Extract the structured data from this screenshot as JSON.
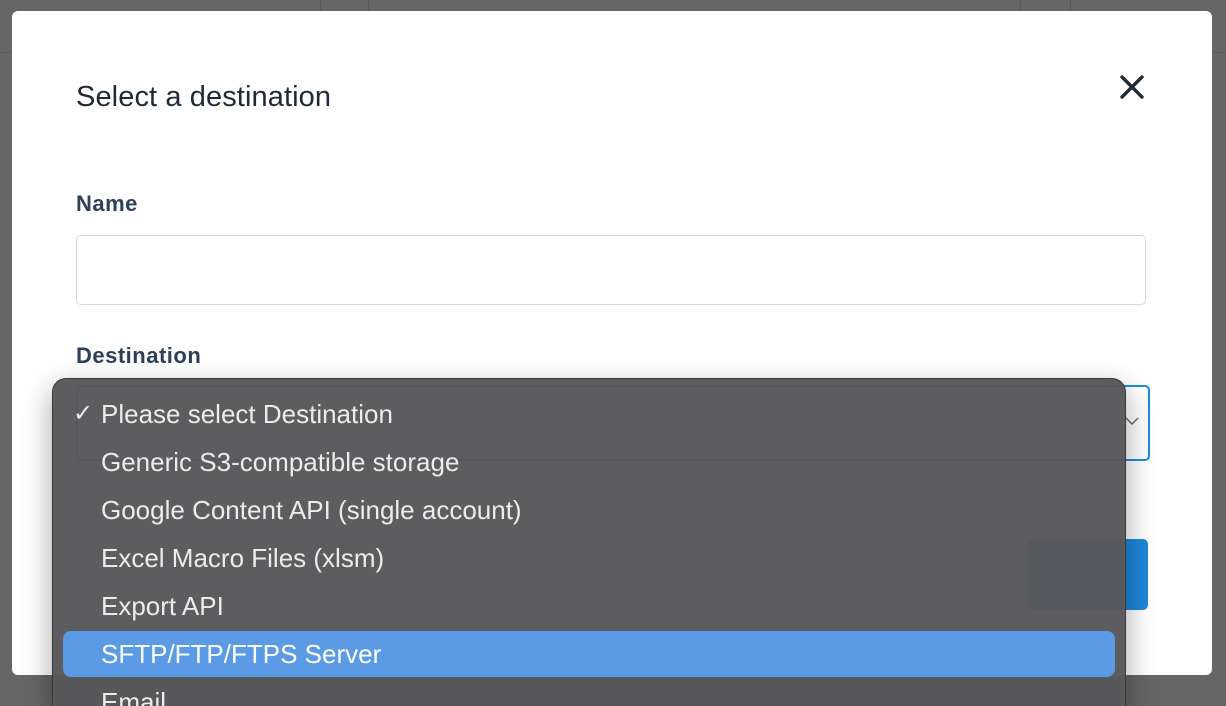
{
  "modal": {
    "title": "Select a destination",
    "close_icon": "close-icon"
  },
  "form": {
    "name_label": "Name",
    "name_value": "",
    "destination_label": "Destination"
  },
  "dropdown": {
    "checked_item": "Please select Destination",
    "highlighted_item": "SFTP/FTP/FTPS Server",
    "options": [
      "Please select Destination",
      "Generic S3-compatible storage",
      "Google Content API (single account)",
      "Excel Macro Files (xlsm)",
      "Export API",
      "SFTP/FTP/FTPS Server",
      "Email"
    ]
  },
  "colors": {
    "accent": "#1e88d9",
    "highlight": "#5b9be6",
    "label": "#2c4057"
  }
}
